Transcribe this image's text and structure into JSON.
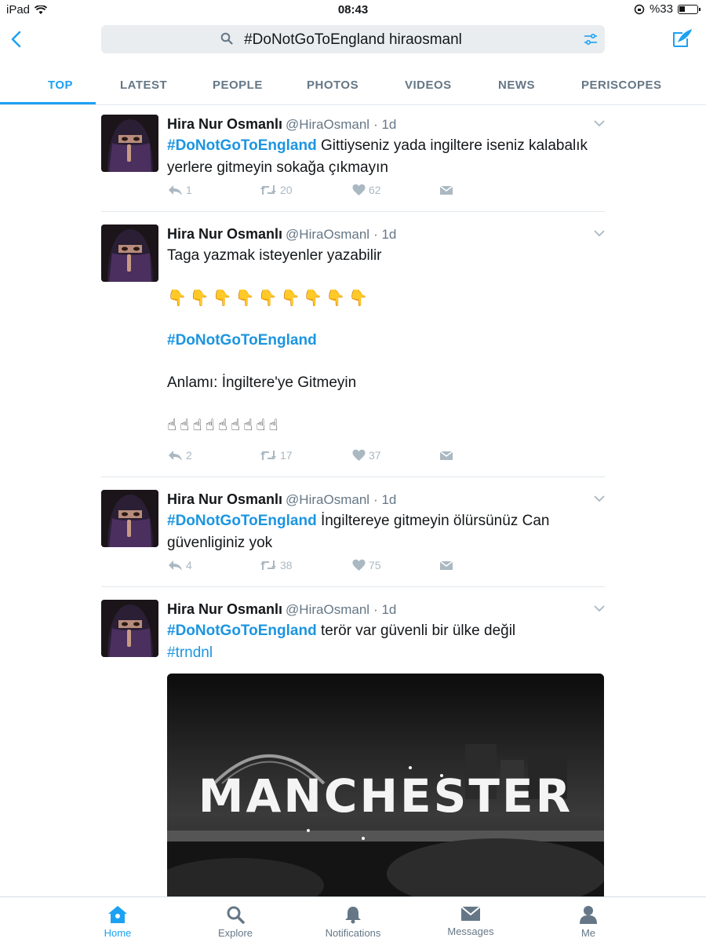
{
  "status_bar": {
    "device": "iPad",
    "time": "08:43",
    "battery": "%33",
    "battery_level": 0.33
  },
  "search": {
    "query": "#DoNotGoToEngland hiraosmanl"
  },
  "tabs": [
    "TOP",
    "LATEST",
    "PEOPLE",
    "PHOTOS",
    "VIDEOS",
    "NEWS",
    "PERISCOPES"
  ],
  "tweets": [
    {
      "name": "Hira Nur Osmanlı",
      "handle": "@HiraOsmanl",
      "time": "· 1d",
      "hashtag": "#DoNotGoToEngland",
      "text": " Gittiyseniz yada ingiltere iseniz kalabalık yerlere gitmeyin sokağa çıkmayın",
      "replies": "1",
      "retweets": "20",
      "likes": "62"
    },
    {
      "name": "Hira Nur Osmanlı",
      "handle": "@HiraOsmanl",
      "time": "· 1d",
      "line1": "Taga yazmak isteyenler yazabilir",
      "emojis_down": "👇👇👇👇👇👇👇👇👇",
      "hashtag": "#DoNotGoToEngland",
      "line2": "Anlamı: İngiltere'ye Gitmeyin",
      "emojis_up": "☝☝☝☝☝☝☝☝☝",
      "replies": "2",
      "retweets": "17",
      "likes": "37"
    },
    {
      "name": "Hira Nur Osmanlı",
      "handle": "@HiraOsmanl",
      "time": "· 1d",
      "hashtag": "#DoNotGoToEngland",
      "text": " İngiltereye gitmeyin ölürsünüz Can güvenliginiz yok",
      "replies": "4",
      "retweets": "38",
      "likes": "75"
    },
    {
      "name": "Hira Nur Osmanlı",
      "handle": "@HiraOsmanl",
      "time": "· 1d",
      "hashtag": "#DoNotGoToEngland",
      "text": " terör var güvenli bir ülke değil",
      "hashtag2": "#trndnl",
      "media_text": "MANCHESTER"
    }
  ],
  "bottom_nav": [
    "Home",
    "Explore",
    "Notifications",
    "Messages",
    "Me"
  ],
  "colors": {
    "accent": "#1da1f2",
    "link": "#1b95e0",
    "muted": "#657786",
    "icon_gray": "#aab8c2"
  }
}
